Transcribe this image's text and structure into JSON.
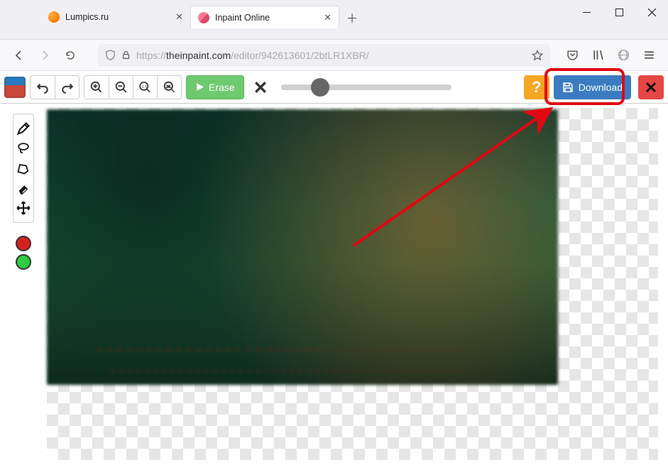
{
  "browser": {
    "tabs": [
      {
        "title": "Lumpics.ru"
      },
      {
        "title": "Inpaint Online"
      }
    ],
    "url_protocol": "https://",
    "url_host": "theinpaint.com",
    "url_path": "/editor/942613601/2btLR1XBR/"
  },
  "toolbar": {
    "erase_label": "Erase",
    "help_label": "?",
    "download_label": "Download"
  }
}
